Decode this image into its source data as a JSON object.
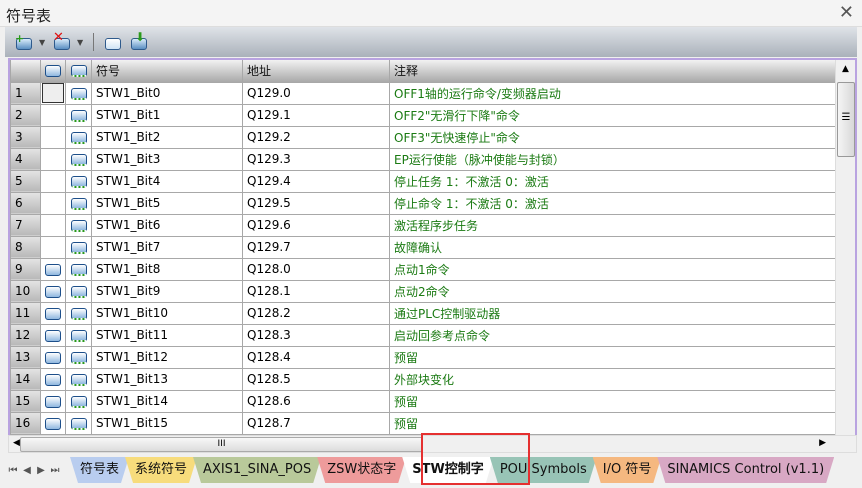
{
  "window": {
    "title": "符号表",
    "close_icon": "close-icon"
  },
  "toolbar": {
    "buttons": [
      "add-symbol-icon",
      "delete-symbol-icon",
      "monitor-icon",
      "import-icon"
    ]
  },
  "table": {
    "headers": [
      "符号",
      "地址",
      "注释"
    ],
    "rows": [
      {
        "n": "1",
        "sym": "STW1_Bit0",
        "addr": "Q129.0",
        "comment": "OFF1轴的运行命令/变频器启动",
        "hmi": false,
        "selected": true
      },
      {
        "n": "2",
        "sym": "STW1_Bit1",
        "addr": "Q129.1",
        "comment": "OFF2\"无滑行下降\"命令",
        "hmi": false
      },
      {
        "n": "3",
        "sym": "STW1_Bit2",
        "addr": "Q129.2",
        "comment": "OFF3\"无快速停止\"命令",
        "hmi": false
      },
      {
        "n": "4",
        "sym": "STW1_Bit3",
        "addr": "Q129.3",
        "comment": "EP运行使能（脉冲使能与封锁）",
        "hmi": false
      },
      {
        "n": "5",
        "sym": "STW1_Bit4",
        "addr": "Q129.4",
        "comment": "停止任务 1：不激活 0：激活",
        "hmi": false
      },
      {
        "n": "6",
        "sym": "STW1_Bit5",
        "addr": "Q129.5",
        "comment": "停止命令 1：不激活 0：激活",
        "hmi": false
      },
      {
        "n": "7",
        "sym": "STW1_Bit6",
        "addr": "Q129.6",
        "comment": "激活程序步任务",
        "hmi": false
      },
      {
        "n": "8",
        "sym": "STW1_Bit7",
        "addr": "Q129.7",
        "comment": "故障确认",
        "hmi": false
      },
      {
        "n": "9",
        "sym": "STW1_Bit8",
        "addr": "Q128.0",
        "comment": "点动1命令",
        "hmi": true
      },
      {
        "n": "10",
        "sym": "STW1_Bit9",
        "addr": "Q128.1",
        "comment": "点动2命令",
        "hmi": true
      },
      {
        "n": "11",
        "sym": "STW1_Bit10",
        "addr": "Q128.2",
        "comment": "通过PLC控制驱动器",
        "hmi": true
      },
      {
        "n": "12",
        "sym": "STW1_Bit11",
        "addr": "Q128.3",
        "comment": "启动回参考点命令",
        "hmi": true
      },
      {
        "n": "13",
        "sym": "STW1_Bit12",
        "addr": "Q128.4",
        "comment": "预留",
        "hmi": true
      },
      {
        "n": "14",
        "sym": "STW1_Bit13",
        "addr": "Q128.5",
        "comment": "外部块变化",
        "hmi": true
      },
      {
        "n": "15",
        "sym": "STW1_Bit14",
        "addr": "Q128.6",
        "comment": "预留",
        "hmi": true
      },
      {
        "n": "16",
        "sym": "STW1_Bit15",
        "addr": "Q128.7",
        "comment": "预留",
        "hmi": true
      }
    ]
  },
  "tabs": [
    {
      "label": "符号表",
      "color": "#b9cdef"
    },
    {
      "label": "系统符号",
      "color": "#f7dc7c"
    },
    {
      "label": "AXIS1_SINA_POS",
      "color": "#b9c99a"
    },
    {
      "label": "ZSW状态字",
      "color": "#ee9b9b"
    },
    {
      "label": "STW控制字",
      "color": "#ffffff",
      "active": true
    },
    {
      "label": "POU Symbols",
      "color": "#98c4b6"
    },
    {
      "label": "I/O 符号",
      "color": "#f5b880"
    },
    {
      "label": "SINAMICS Control (v1.1)",
      "color": "#d8a8c4"
    }
  ],
  "scroll": {
    "thumb_grip": "III",
    "v_grip": "☰"
  }
}
